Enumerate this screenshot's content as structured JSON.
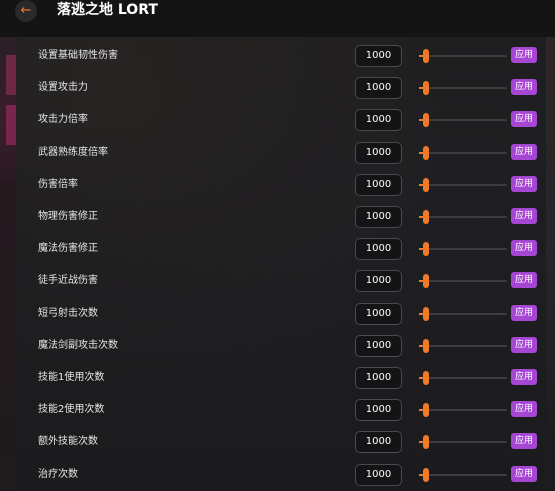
{
  "header": {
    "back_icon": "←",
    "title": "落逃之地 LORT"
  },
  "colors": {
    "accent": "#f07a2a",
    "apply": "#a746d4"
  },
  "cheats": [
    {
      "label": "设置基础韧性伤害",
      "value": "1000",
      "apply": "应用",
      "level": 0.05
    },
    {
      "label": "设置攻击力",
      "value": "1000",
      "apply": "应用",
      "level": 0.05
    },
    {
      "label": "攻击力倍率",
      "value": "1000",
      "apply": "应用",
      "level": 0.05
    },
    {
      "label": "武器熟练度倍率",
      "value": "1000",
      "apply": "应用",
      "level": 0.05
    },
    {
      "label": "伤害倍率",
      "value": "1000",
      "apply": "应用",
      "level": 0.05
    },
    {
      "label": "物理伤害修正",
      "value": "1000",
      "apply": "应用",
      "level": 0.05
    },
    {
      "label": "魔法伤害修正",
      "value": "1000",
      "apply": "应用",
      "level": 0.05
    },
    {
      "label": "徒手近战伤害",
      "value": "1000",
      "apply": "应用",
      "level": 0.05
    },
    {
      "label": "短弓射击次数",
      "value": "1000",
      "apply": "应用",
      "level": 0.05
    },
    {
      "label": "魔法剑副攻击次数",
      "value": "1000",
      "apply": "应用",
      "level": 0.05
    },
    {
      "label": "技能1使用次数",
      "value": "1000",
      "apply": "应用",
      "level": 0.05
    },
    {
      "label": "技能2使用次数",
      "value": "1000",
      "apply": "应用",
      "level": 0.05
    },
    {
      "label": "额外技能次数",
      "value": "1000",
      "apply": "应用",
      "level": 0.05
    },
    {
      "label": "治疗次数",
      "value": "1000",
      "apply": "应用",
      "level": 0.05
    }
  ]
}
